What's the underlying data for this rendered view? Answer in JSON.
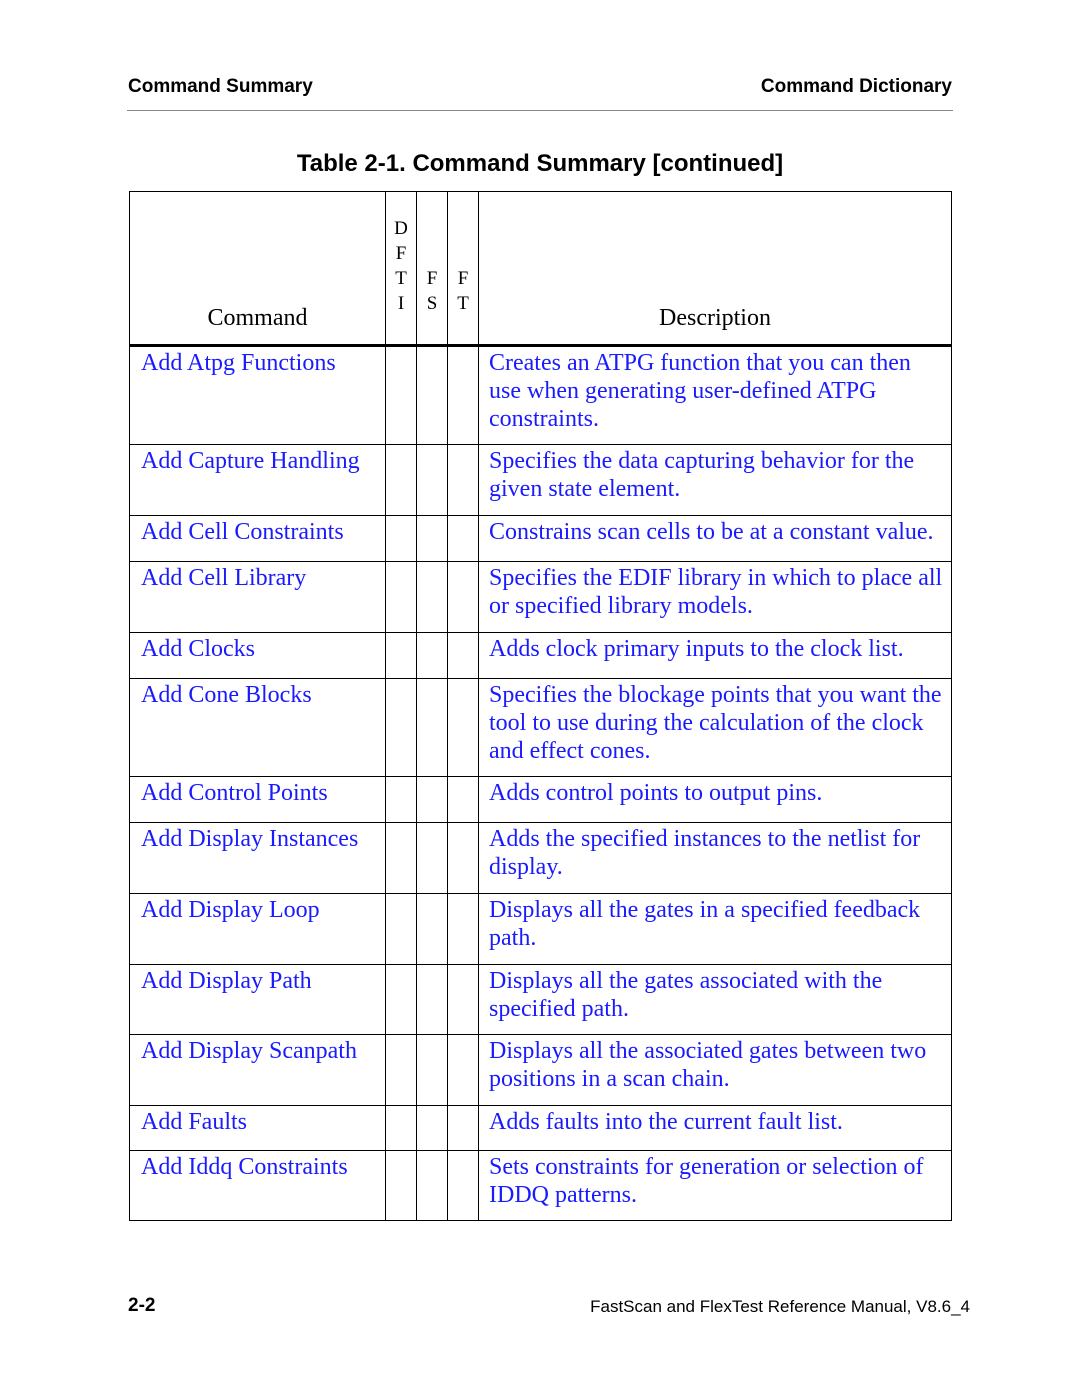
{
  "header": {
    "left": "Command Summary",
    "right": "Command Dictionary"
  },
  "table_title": "Table 2-1. Command Summary [continued]",
  "table": {
    "columns": {
      "command": "Command",
      "dfti": [
        "D",
        "F",
        "T",
        "I"
      ],
      "fs": [
        "F",
        "S"
      ],
      "ft": [
        "F",
        "T"
      ],
      "description": "Description"
    },
    "rows": [
      {
        "command": "Add Atpg Functions",
        "description": "Creates an ATPG function that you can then use when generating user-defined ATPG constraints.",
        "dfti": "",
        "fs": "",
        "ft": ""
      },
      {
        "command": "Add Capture Handling",
        "description": "Specifies the data capturing behavior for the given state element.",
        "dfti": "",
        "fs": "",
        "ft": ""
      },
      {
        "command": "Add Cell Constraints",
        "description": "Constrains scan cells to be at a constant value.",
        "dfti": "",
        "fs": "",
        "ft": ""
      },
      {
        "command": "Add Cell Library",
        "description": "Specifies the EDIF library in which to place all or specified library models.",
        "dfti": "",
        "fs": "",
        "ft": ""
      },
      {
        "command": "Add Clocks",
        "description": "Adds clock primary inputs to the clock list.",
        "dfti": "",
        "fs": "",
        "ft": ""
      },
      {
        "command": "Add Cone Blocks",
        "description": "Specifies the blockage points that you want the tool to use during the calculation of the clock and effect cones.",
        "dfti": "",
        "fs": "",
        "ft": ""
      },
      {
        "command": "Add Control Points",
        "description": "Adds control points to output pins.",
        "dfti": "",
        "fs": "",
        "ft": ""
      },
      {
        "command": "Add Display Instances",
        "description": "Adds the specified instances to the netlist for display.",
        "dfti": "",
        "fs": "",
        "ft": ""
      },
      {
        "command": "Add Display Loop",
        "description": "Displays all the gates in a specified feedback path.",
        "dfti": "",
        "fs": "",
        "ft": ""
      },
      {
        "command": "Add Display Path",
        "description": "Displays all the gates associated with the specified path.",
        "dfti": "",
        "fs": "",
        "ft": ""
      },
      {
        "command": "Add Display Scanpath",
        "description": "Displays all the associated gates between two positions in a scan chain.",
        "dfti": "",
        "fs": "",
        "ft": ""
      },
      {
        "command": "Add Faults",
        "description": "Adds faults into the current fault list.",
        "dfti": "",
        "fs": "",
        "ft": ""
      },
      {
        "command": "Add Iddq Constraints",
        "description": "Sets constraints for generation or selection of IDDQ patterns.",
        "dfti": "",
        "fs": "",
        "ft": ""
      }
    ]
  },
  "footer": {
    "page_number": "2-2",
    "manual_title": "FastScan and FlexTest Reference Manual, V8.6_4"
  },
  "colors": {
    "link_text": "#1a1aff",
    "body_text": "#000000"
  }
}
